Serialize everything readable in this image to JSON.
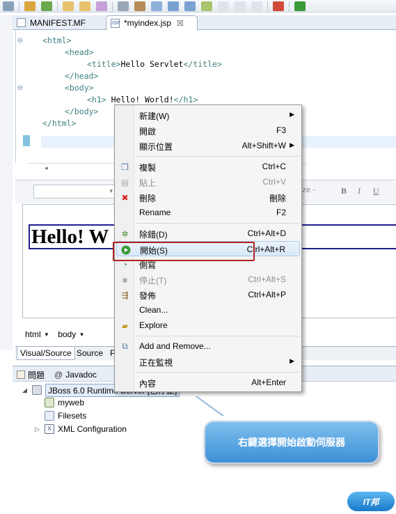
{
  "editor": {
    "tabs": [
      {
        "label": "MANIFEST.MF",
        "icon": "manifest-file-icon"
      },
      {
        "label": "*myindex.jsp",
        "icon": "jsp-file-icon",
        "close": "☒"
      }
    ],
    "code_lines": [
      {
        "open": "<html>",
        "text": "",
        "close": ""
      },
      {
        "open": "<head>",
        "text": "",
        "close": ""
      },
      {
        "open": "<title>",
        "text": "Hello Servlet",
        "close": "</title>"
      },
      {
        "open": "</head>",
        "text": "",
        "close": ""
      },
      {
        "open": "<body>",
        "text": "",
        "close": ""
      },
      {
        "open": "<h1>",
        "text": " Hello! World!",
        "close": "</h1>"
      },
      {
        "open": "</body>",
        "text": "",
        "close": ""
      },
      {
        "open": "</html>",
        "text": "",
        "close": ""
      }
    ]
  },
  "visual": {
    "size_combo": "ize -",
    "format_buttons": [
      "B",
      "I",
      "U"
    ],
    "h1_preview": "Hello! W"
  },
  "breadcrumb": {
    "items": [
      "html",
      "body"
    ]
  },
  "bottom_tabs": [
    "Visual/Source",
    "Source",
    "P"
  ],
  "views": {
    "tabs": [
      {
        "label": "問題",
        "icon": "problems-icon"
      },
      {
        "label": "Javadoc",
        "icon": "javadoc-icon"
      }
    ],
    "tree": [
      {
        "label": "JBoss 6.0 Runtime Server  [已停止]",
        "icon": "server-icon"
      },
      {
        "label": "myweb",
        "icon": "project-icon"
      },
      {
        "label": "Filesets",
        "icon": "filesets-icon"
      },
      {
        "label": "XML Configuration",
        "icon": "xml-icon"
      }
    ]
  },
  "menu": {
    "items": [
      {
        "label": "新建(W)",
        "shortcut": "",
        "submenu": true,
        "icon": ""
      },
      {
        "label": "開啟",
        "shortcut": "F3",
        "submenu": false,
        "icon": ""
      },
      {
        "label": "顯示位置",
        "shortcut": "Alt+Shift+W",
        "submenu": true,
        "icon": ""
      },
      {
        "label": "複製",
        "shortcut": "Ctrl+C",
        "submenu": false,
        "icon": "copy-icon"
      },
      {
        "label": "貼上",
        "shortcut": "Ctrl+V",
        "submenu": false,
        "icon": "paste-icon",
        "disabled": true
      },
      {
        "label": "刪除",
        "shortcut": "刪除",
        "submenu": false,
        "icon": "delete-icon"
      },
      {
        "label": "Rename",
        "shortcut": "F2",
        "submenu": false,
        "icon": ""
      },
      {
        "label": "除錯(D)",
        "shortcut": "Ctrl+Alt+D",
        "submenu": false,
        "icon": "debug-icon"
      },
      {
        "label": "開始(S)",
        "shortcut": "Ctrl+Alt+R",
        "submenu": false,
        "icon": "start-icon"
      },
      {
        "label": "側寫",
        "shortcut": "",
        "submenu": false,
        "icon": "profile-icon"
      },
      {
        "label": "停止(T)",
        "shortcut": "Ctrl+Alt+S",
        "submenu": false,
        "icon": "stop-icon",
        "disabled": true
      },
      {
        "label": "發佈",
        "shortcut": "Ctrl+Alt+P",
        "submenu": false,
        "icon": "publish-icon"
      },
      {
        "label": "Clean...",
        "shortcut": "",
        "submenu": false,
        "icon": ""
      },
      {
        "label": "Explore",
        "shortcut": "",
        "submenu": false,
        "icon": "explore-icon"
      },
      {
        "label": "Add and Remove...",
        "shortcut": "",
        "submenu": false,
        "icon": "add-remove-icon"
      },
      {
        "label": "正在監視",
        "shortcut": "",
        "submenu": true,
        "icon": ""
      },
      {
        "label": "內容",
        "shortcut": "Alt+Enter",
        "submenu": false,
        "icon": ""
      }
    ]
  },
  "callout": {
    "text": "右鍵選擇開始啟動伺服器"
  },
  "logo": {
    "text": "IT邦"
  },
  "colors": {
    "accent": "#3d8fd6",
    "highlight_border": "#b22222",
    "tag": "#3f7f7f"
  }
}
